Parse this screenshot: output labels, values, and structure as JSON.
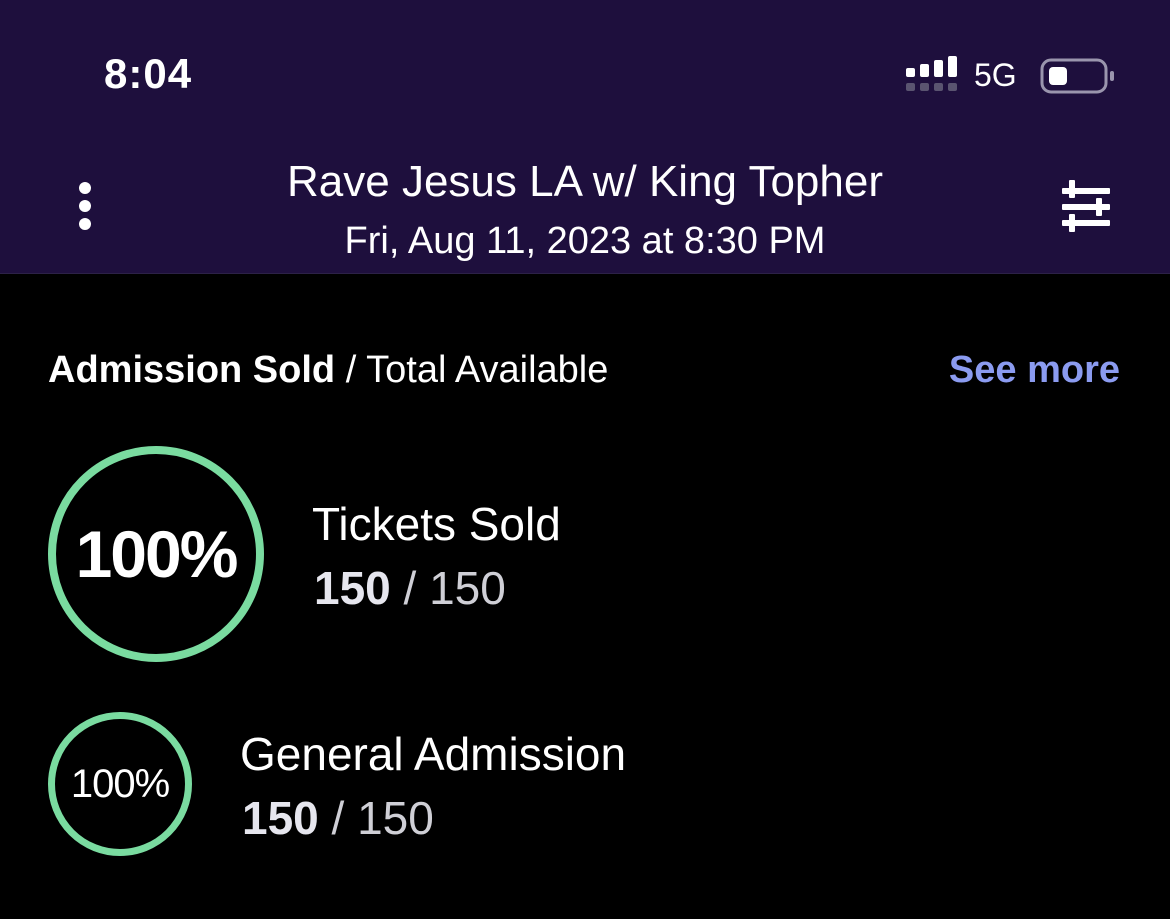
{
  "status_bar": {
    "time": "8:04",
    "network": "5G"
  },
  "header": {
    "title": "Rave Jesus LA w/ King Topher",
    "date": "Fri, Aug 11, 2023 at 8:30 PM",
    "menu_icon": "more-vertical-icon",
    "filter_icon": "sliders-icon"
  },
  "section": {
    "heading_strong": "Admission Sold",
    "heading_rest": " / Total Available",
    "see_more": "See more"
  },
  "summary": {
    "percent_label": "100%",
    "percent_value": 1.0,
    "label": "Tickets Sold",
    "sold": "150",
    "separator": " / ",
    "total": "150"
  },
  "ticket_types": [
    {
      "percent_label": "100%",
      "percent_value": 1.0,
      "label": "General Admission",
      "sold": "150",
      "separator": " / ",
      "total": "150"
    }
  ],
  "colors": {
    "header_bg": "#1e0f3d",
    "accent_link": "#8b9bf0",
    "ring_green": "#7adba0",
    "background": "#000000"
  }
}
